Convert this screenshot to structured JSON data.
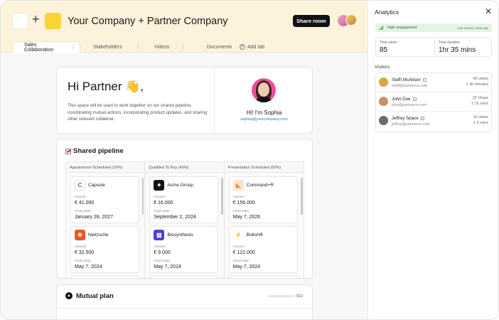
{
  "header": {
    "company_title": "Your Company + Partner Company",
    "plus": "+",
    "share_label": "Share room",
    "tabs": [
      {
        "label": "Sales Collaboration",
        "active": true
      },
      {
        "label": "Stakeholders",
        "active": false
      },
      {
        "label": "Videos",
        "active": false
      },
      {
        "label": "Documents",
        "active": false
      }
    ],
    "tab_menu_glyph": "⋮",
    "add_tab_label": "Add tab"
  },
  "hero": {
    "title": "Hi Partner 👋,",
    "text": "This space will be used to work together on our shared pipeline, coordinating mutual actions, incorporating product updates, and sharing other relevant collateral.",
    "owner_name": "Hi! I'm Sophia",
    "owner_email": "sophia@yourcompany.com"
  },
  "pipeline": {
    "title": "Shared pipeline",
    "columns": [
      {
        "header": "Appointment Scheduled (20%)",
        "deals": [
          {
            "name": "Capsule",
            "logo_color": "#ffffff",
            "logo_glyph": "C",
            "amount_label": "Amount:",
            "amount": "€ 41.000",
            "date_label": "Close Date:",
            "date": "January 28, 2027"
          },
          {
            "name": "Nietzsche",
            "logo_color": "#f0541e",
            "logo_glyph": "✻",
            "amount_label": "Amount:",
            "amount": "€ 32.500",
            "date_label": "Close Date:",
            "date": "May 7, 2024"
          }
        ],
        "peek_color": "#e78ad2"
      },
      {
        "header": "Qualified To Buy (40%)",
        "deals": [
          {
            "name": "Acme Group",
            "logo_color": "#141414",
            "logo_glyph": "✦",
            "amount_label": "Amount:",
            "amount": "€ 16.000",
            "date_label": "Close Date:",
            "date": "September 2, 2024"
          },
          {
            "name": "Biosynthesis",
            "logo_color": "#4b3fd6",
            "logo_glyph": "▨",
            "amount_label": "Amount:",
            "amount": "€ 9.000",
            "date_label": "Close Date:",
            "date": "May 7, 2024"
          }
        ],
        "peek_color": "#f5c62a"
      },
      {
        "header": "Presentation Scheduled (60%)",
        "deals": [
          {
            "name": "Command+R",
            "logo_color": "#f58a3a",
            "logo_glyph": "◣",
            "amount_label": "Amount:",
            "amount": "€ 156.000",
            "date_label": "Close Date:",
            "date": "May 7, 2026"
          },
          {
            "name": "Boltshift",
            "logo_color": "#2f6fe0",
            "logo_glyph": "⚡",
            "amount_label": "Amount:",
            "amount": "€ 122.000",
            "date_label": "Close Date:",
            "date": "May 7, 2024"
          }
        ],
        "peek_color": "#8f5fe8"
      }
    ]
  },
  "mutual_plan": {
    "title": "Mutual plan",
    "progress_count": "0/2",
    "progress_fraction": 0
  },
  "analytics": {
    "title": "Analytics",
    "close_glyph": "✕",
    "engagement_label": "High engagement",
    "last_viewed": "Last viewed 3 days ago",
    "total_views_label": "Total views",
    "total_views": "85",
    "total_duration_label": "Total duration",
    "total_duration": "1hr 35 mins",
    "visitors_label": "Visitors",
    "visitors": [
      {
        "name": "Steffi McAlison",
        "email": "steffi@partnerco.com",
        "views": "40 views",
        "minutes": "± 30 minutes",
        "avatar_color": "#e0a43a"
      },
      {
        "name": "John Doe",
        "email": "john@partnerco.com",
        "views": "25 Views",
        "minutes": "± 15 mins",
        "avatar_color": "#c98f6d"
      },
      {
        "name": "Jeffrey Space",
        "email": "jeffrey@partnerco.com",
        "views": "10 views",
        "minutes": "± 5 mins",
        "avatar_color": "#6c6c6c"
      }
    ]
  },
  "colors": {
    "header_bg": "#fdf3dc",
    "brand_yellow": "#fcd535",
    "engagement_green": "#e3f3e5",
    "link_blue": "#2f6fd6"
  }
}
